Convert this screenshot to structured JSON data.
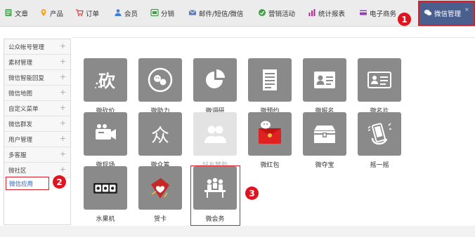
{
  "nav": {
    "items": [
      {
        "label": "文章",
        "icon": "document-icon",
        "color": "#4caf50"
      },
      {
        "label": "产品",
        "icon": "location-pin-icon",
        "color": "#f5a623"
      },
      {
        "label": "订单",
        "icon": "cart-icon",
        "color": "#e53935"
      },
      {
        "label": "会员",
        "icon": "person-icon",
        "color": "#3f7fd6"
      },
      {
        "label": "分销",
        "icon": "distribution-icon",
        "color": "#43a047"
      },
      {
        "label": "邮件/短信/微信",
        "icon": "mail-icon",
        "color": "#5c7bb8"
      },
      {
        "label": "营销活动",
        "icon": "marketing-icon",
        "color": "#43a047"
      },
      {
        "label": "统计报表",
        "icon": "bar-chart-icon",
        "color": "#9c27b0"
      },
      {
        "label": "电子商务",
        "icon": "card-icon",
        "color": "#8e44ad"
      },
      {
        "label": "微信管理",
        "icon": "wechat-icon",
        "close": "×"
      }
    ],
    "active_bg": "#4b5f8f"
  },
  "sidebar": {
    "items": [
      {
        "label": "公众帐号管理",
        "expand": "+"
      },
      {
        "label": "素材管理",
        "expand": "+"
      },
      {
        "label": "微信智能回复",
        "expand": "+"
      },
      {
        "label": "微信地图",
        "expand": "+"
      },
      {
        "label": "自定义菜单",
        "expand": "+"
      },
      {
        "label": "微信群发",
        "expand": "+"
      },
      {
        "label": "用户管理",
        "expand": "+"
      },
      {
        "label": "多客服",
        "expand": "+"
      },
      {
        "label": "微社区",
        "expand": "+"
      },
      {
        "label": "微信应用",
        "active": true
      }
    ]
  },
  "apps": [
    {
      "label": "微砍价",
      "icon": "bargain-icon"
    },
    {
      "label": "微助力",
      "icon": "assist-icon"
    },
    {
      "label": "微调研",
      "icon": "survey-icon"
    },
    {
      "label": "微预约",
      "icon": "appointment-icon"
    },
    {
      "label": "微报名",
      "icon": "signup-icon"
    },
    {
      "label": "微名片",
      "icon": "business-card-icon"
    },
    {
      "label": "微现场",
      "icon": "video-camera-icon"
    },
    {
      "label": "微众筹",
      "icon": "crowdfunding-icon"
    },
    {
      "label": "好友赞助",
      "icon": "friends-icon",
      "disabled": true
    },
    {
      "label": "微红包",
      "icon": "red-envelope-icon"
    },
    {
      "label": "微夺宝",
      "icon": "treasure-chest-icon"
    },
    {
      "label": "摇一摇",
      "icon": "shake-phone-icon"
    },
    {
      "label": "水果机",
      "icon": "slot-machine-icon"
    },
    {
      "label": "贺卡",
      "icon": "greeting-card-icon"
    },
    {
      "label": "微会务",
      "icon": "meeting-icon"
    }
  ],
  "badges": {
    "one": "1",
    "two": "2",
    "three": "3"
  },
  "colors": {
    "annotation_red": "#d9202a",
    "tile_gray": "#8a8a8a",
    "link_blue": "#2b5fb4"
  }
}
